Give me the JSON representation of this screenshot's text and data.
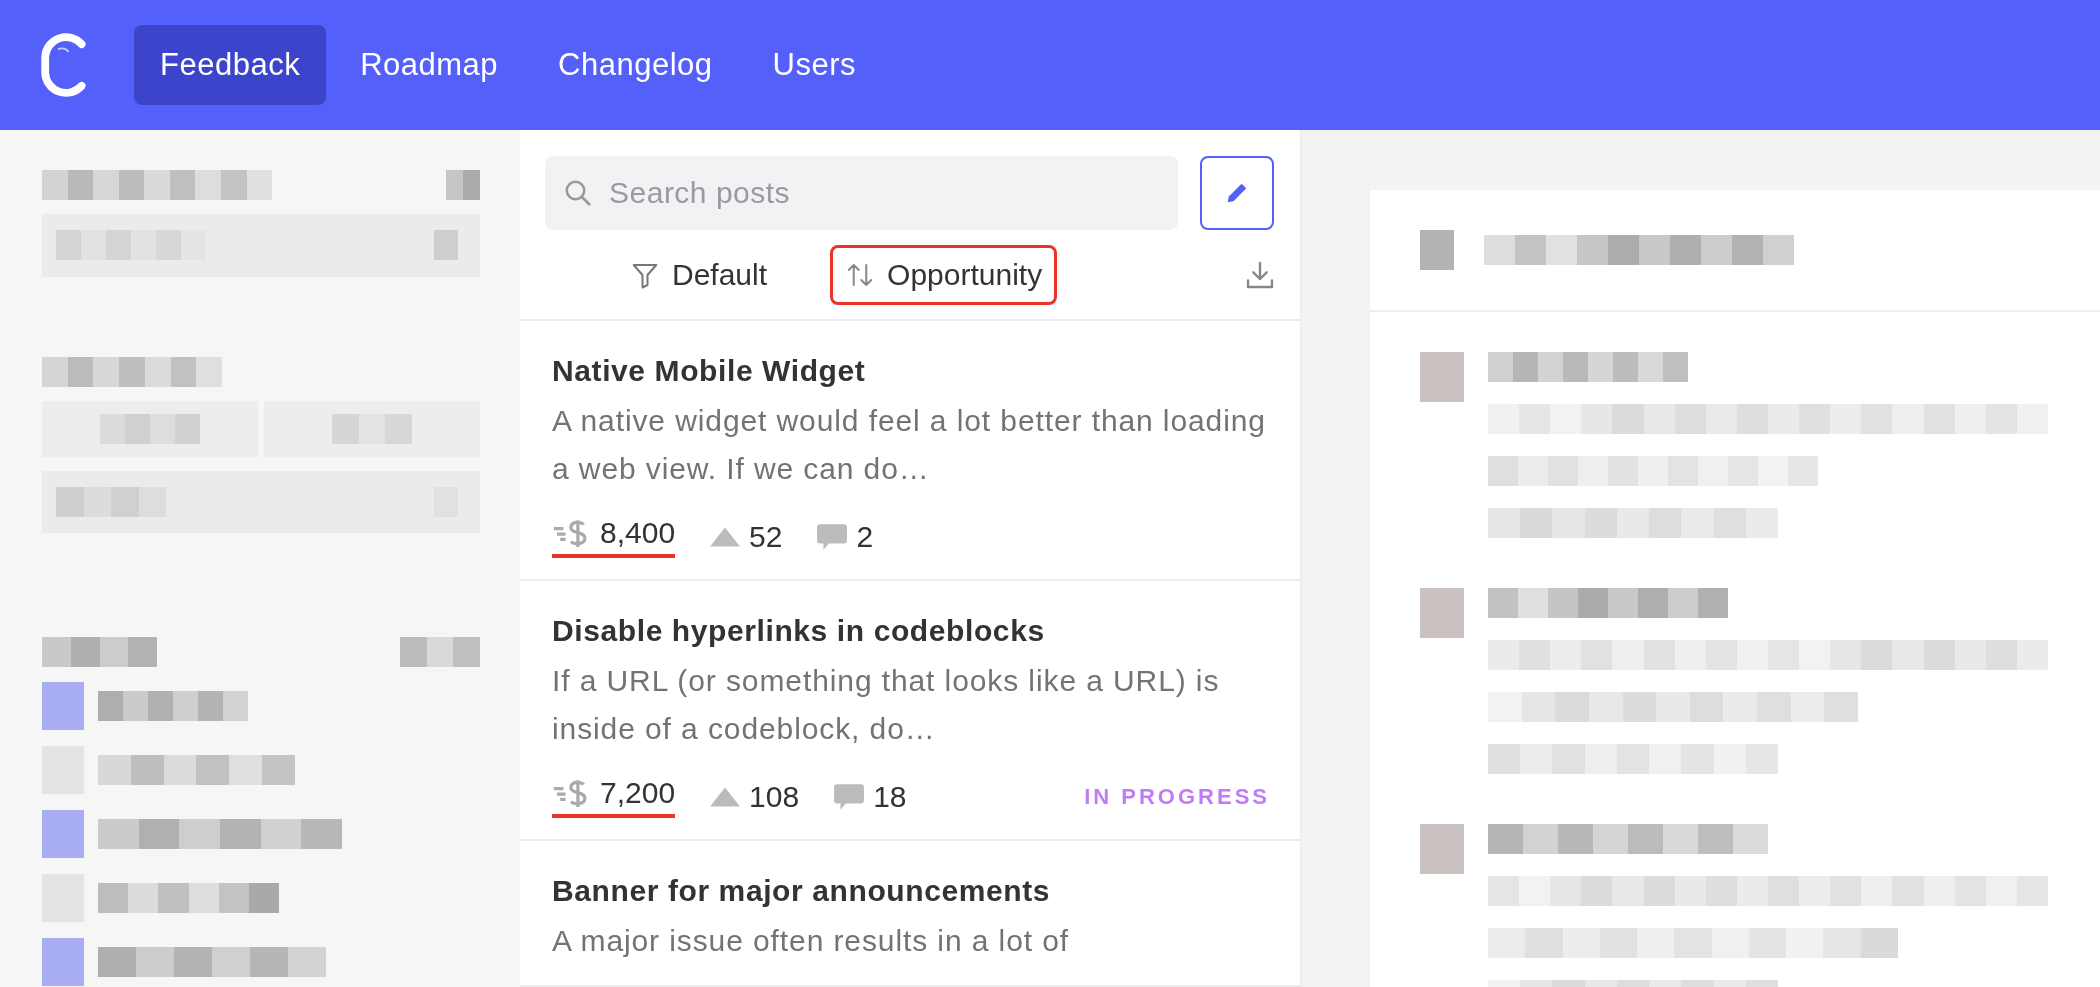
{
  "nav": {
    "tabs": [
      {
        "label": "Feedback",
        "selected": true
      },
      {
        "label": "Roadmap",
        "selected": false
      },
      {
        "label": "Changelog",
        "selected": false
      },
      {
        "label": "Users",
        "selected": false
      }
    ]
  },
  "search": {
    "placeholder": "Search posts"
  },
  "toolbar": {
    "filter": {
      "label": "Default",
      "highlighted": false
    },
    "sort": {
      "label": "Opportunity",
      "highlighted": true
    }
  },
  "posts": [
    {
      "title": "Native Mobile Widget",
      "excerpt": "A native widget would feel a lot better than loading a web view. If we can do…",
      "opportunity": "8,400",
      "opportunity_underlined": true,
      "votes": "52",
      "comments": "2"
    },
    {
      "title": "Disable hyperlinks in codeblocks",
      "excerpt": "If a URL (or something that looks like a URL) is inside of a codeblock, do…",
      "opportunity": "7,200",
      "opportunity_underlined": true,
      "votes": "108",
      "comments": "18",
      "status": "IN PROGRESS",
      "color": "#c07cf8"
    },
    {
      "title": "Banner for major announcements",
      "excerpt": "A major issue often results in a lot of"
    }
  ]
}
